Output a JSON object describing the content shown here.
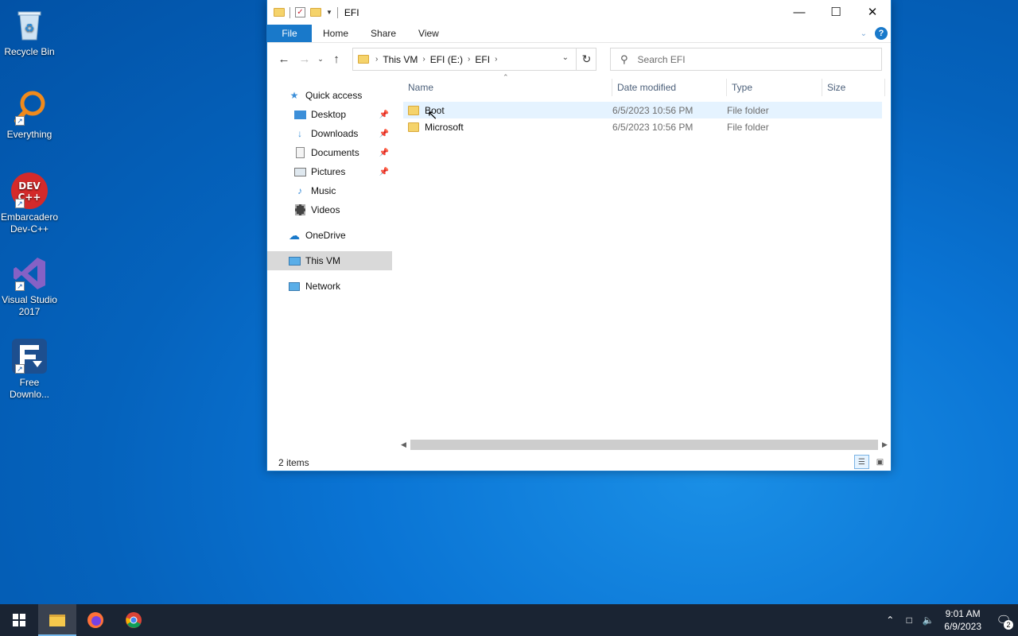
{
  "desktop": {
    "icons": [
      {
        "label": "Recycle Bin",
        "icon": "recycle-bin-icon"
      },
      {
        "label": "Everything",
        "icon": "everything-search-icon"
      },
      {
        "label": "Embarcadero Dev-C++",
        "icon": "devcpp-icon",
        "badge": "DEV C++"
      },
      {
        "label": "Visual Studio 2017",
        "icon": "visual-studio-icon"
      },
      {
        "label": "Free Downlo...",
        "icon": "free-download-manager-icon"
      }
    ]
  },
  "window": {
    "title": "EFI",
    "ribbon_tabs": [
      "File",
      "Home",
      "Share",
      "View"
    ],
    "address": {
      "crumbs": [
        "This VM",
        "EFI (E:)",
        "EFI"
      ]
    },
    "search_placeholder": "Search EFI",
    "nav_pane": {
      "quick_access": "Quick access",
      "pinned": [
        "Desktop",
        "Downloads",
        "Documents",
        "Pictures"
      ],
      "unpinned": [
        "Music",
        "Videos"
      ],
      "onedrive": "OneDrive",
      "this_vm": "This VM",
      "network": "Network"
    },
    "columns": [
      "Name",
      "Date modified",
      "Type",
      "Size"
    ],
    "files": [
      {
        "name": "Boot",
        "date": "6/5/2023 10:56 PM",
        "type": "File folder",
        "size": ""
      },
      {
        "name": "Microsoft",
        "date": "6/5/2023 10:56 PM",
        "type": "File folder",
        "size": ""
      }
    ],
    "status": "2 items",
    "accent": "#1979ca"
  },
  "taskbar": {
    "time": "9:01 AM",
    "date": "6/9/2023",
    "notifications": "2"
  }
}
